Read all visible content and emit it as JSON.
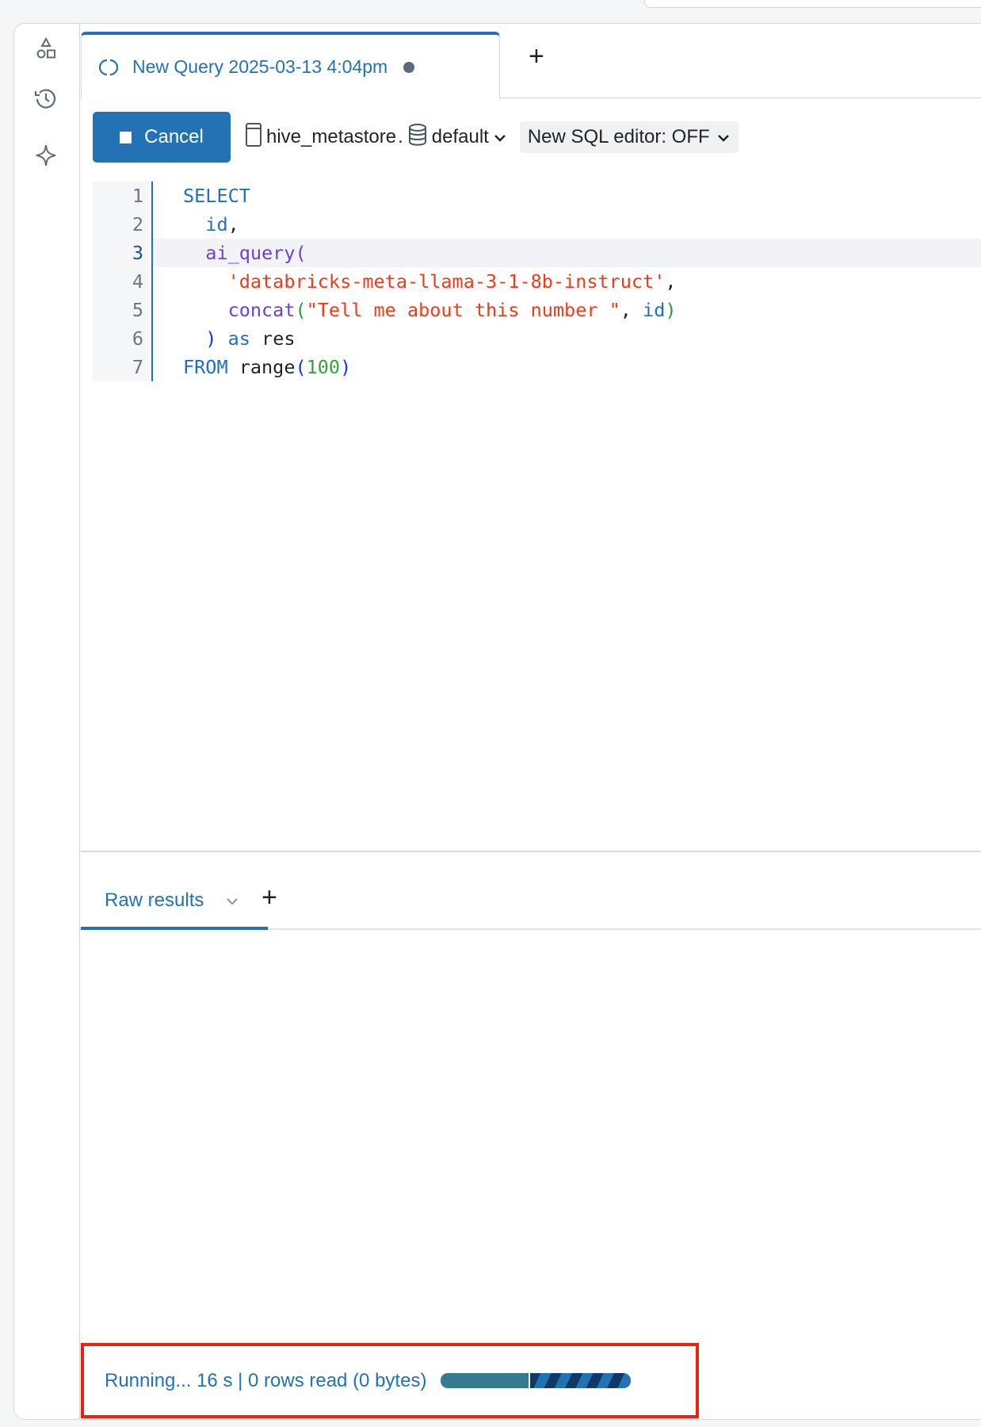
{
  "query_tab": {
    "title": "New Query 2025-03-13 4:04pm",
    "status_icon": "loading-spinner-icon",
    "unsaved": true
  },
  "toolbar": {
    "cancel_label": "Cancel",
    "catalog": "hive_metastore",
    "separator": ".",
    "schema": "default",
    "sql_editor_toggle": "New SQL editor: OFF"
  },
  "editor": {
    "active_line": 3,
    "lines": [
      {
        "n": "1",
        "code": "SELECT"
      },
      {
        "n": "2",
        "code": "  id,"
      },
      {
        "n": "3",
        "code": "  ai_query("
      },
      {
        "n": "4",
        "code": "    'databricks-meta-llama-3-1-8b-instruct',"
      },
      {
        "n": "5",
        "code": "    concat(\"Tell me about this number \", id)"
      },
      {
        "n": "6",
        "code": "  ) as res"
      },
      {
        "n": "7",
        "code": "FROM range(100)"
      }
    ]
  },
  "results": {
    "tab_label": "Raw results"
  },
  "status": {
    "text": "Running... 16 s | 0 rows read (0 bytes)",
    "progress_done_fraction": 0.47
  },
  "colors": {
    "accent": "#2272b4",
    "highlight_box": "#f0200e"
  }
}
